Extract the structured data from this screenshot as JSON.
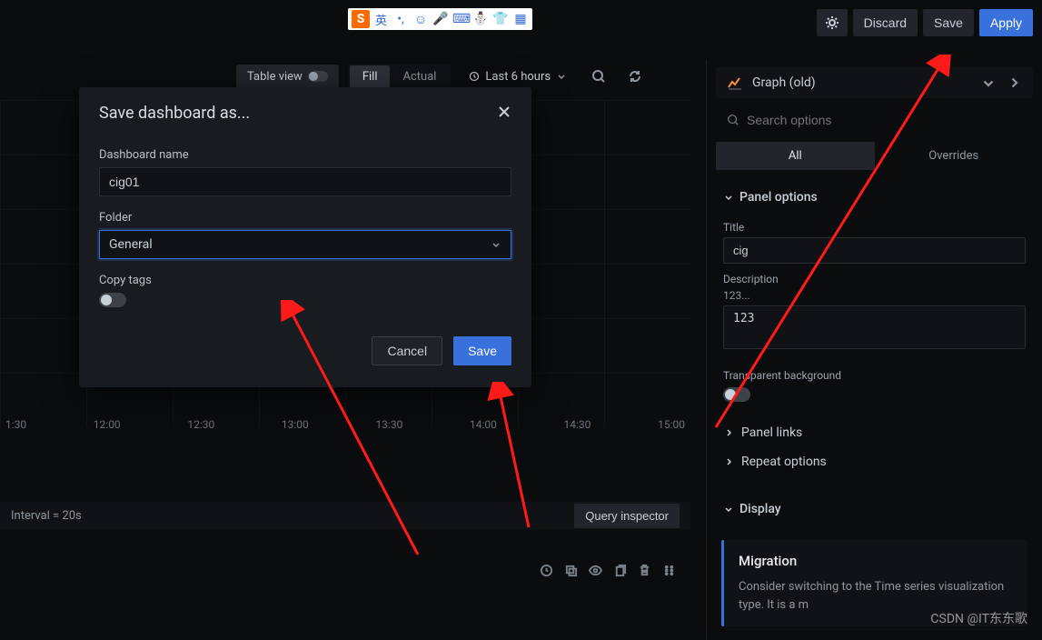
{
  "header": {
    "discard": "Discard",
    "save": "Save",
    "apply": "Apply"
  },
  "toolbar": {
    "table_view": "Table view",
    "fill": "Fill",
    "actual": "Actual",
    "time_range": "Last 6 hours"
  },
  "xticks": [
    "1:30",
    "12:00",
    "12:30",
    "13:00",
    "13:30",
    "14:00",
    "14:30",
    "15:00"
  ],
  "interval_row": {
    "interval": "Interval = 20s",
    "query_inspector": "Query inspector"
  },
  "sidebar": {
    "viz_name": "Graph (old)",
    "search_placeholder": "Search options",
    "tab_all": "All",
    "tab_overrides": "Overrides",
    "panel_options": "Panel options",
    "title_label": "Title",
    "title_value": "cig",
    "desc_label": "Description",
    "desc_preview": "123...",
    "desc_value": "123",
    "transparent": "Transparent background",
    "panel_links": "Panel links",
    "repeat_options": "Repeat options",
    "display": "Display",
    "migration_title": "Migration",
    "migration_text": "Consider switching to the Time series visualization type. It is a m"
  },
  "modal": {
    "title": "Save dashboard as...",
    "name_label": "Dashboard name",
    "name_value": "cig01",
    "folder_label": "Folder",
    "folder_value": "General",
    "copy_tags": "Copy tags",
    "cancel": "Cancel",
    "save": "Save"
  },
  "watermark": "CSDN @IT东东歌",
  "ime": {
    "lang": "英"
  }
}
